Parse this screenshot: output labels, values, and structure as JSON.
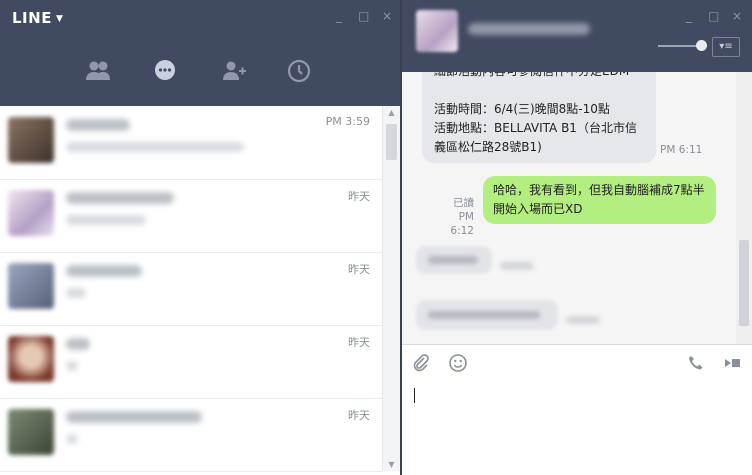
{
  "left_window": {
    "title": "LINE",
    "controls": {
      "minimize": "_",
      "maximize": "□",
      "close": "×"
    },
    "tabs": [
      {
        "name": "friends",
        "icon": "friends-icon"
      },
      {
        "name": "chats",
        "icon": "chat-icon"
      },
      {
        "name": "add-friend",
        "icon": "add-friend-icon"
      },
      {
        "name": "timeline",
        "icon": "clock-icon"
      }
    ],
    "chats": [
      {
        "time": "PM 3:59",
        "avatar_color": "#6d5a4c"
      },
      {
        "time": "昨天",
        "avatar_color": "#cbb9d5"
      },
      {
        "time": "昨天",
        "avatar_color": "#7f8aa6"
      },
      {
        "time": "昨天",
        "avatar_color": "#8c4a3a"
      },
      {
        "time": "昨天",
        "avatar_color": "#5f6d58"
      }
    ]
  },
  "right_window": {
    "controls": {
      "minimize": "_",
      "maximize": "□",
      "close": "×"
    },
    "messages": {
      "incoming_event": {
        "lines": [
          "細節活動內容可參閱信件中分足EDM",
          "",
          "活動時間：6/4(三)晚間8點-10點",
          "活動地點：BELLAVITA B1（台北市信",
          "義區松仁路28號B1)"
        ],
        "time": "PM 6:11"
      },
      "outgoing_reply": {
        "lines": [
          "哈哈，我有看到，但我自動腦補成7點半",
          "開始入場而已XD"
        ],
        "read": "已讀",
        "time": "PM 6:12"
      }
    },
    "input_placeholder": ""
  },
  "colors": {
    "titlebar": "#404a61",
    "outgoing_bubble": "#b3ee80",
    "incoming_bubble": "#e6e7ea"
  }
}
